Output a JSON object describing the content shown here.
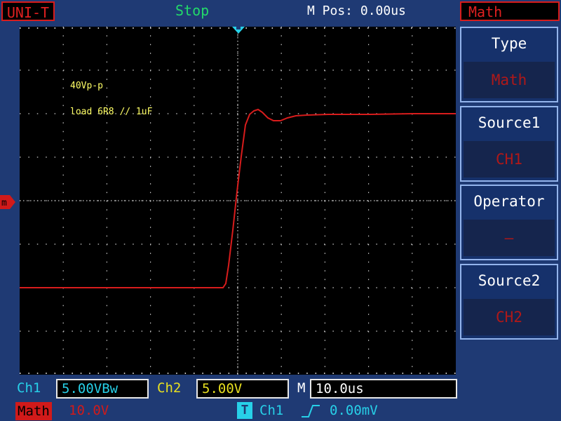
{
  "header": {
    "brand": "UNI-T",
    "run_status": "Stop",
    "m_pos": "M Pos: 0.00us"
  },
  "menu": {
    "title": "Math",
    "items": [
      {
        "label": "Type",
        "value": "Math"
      },
      {
        "label": "Source1",
        "value": "CH1"
      },
      {
        "label": "Operator",
        "value": "—"
      },
      {
        "label": "Source2",
        "value": "CH2"
      }
    ]
  },
  "screen": {
    "annotations": [
      "40Vp-p",
      "load 6R8 // 1uF"
    ],
    "trace_color": "#d81c1c",
    "grid_color": "#cccccc"
  },
  "bottom": {
    "ch1_label": "Ch1",
    "ch1_scale": "5.00VBw",
    "ch2_label": "Ch2",
    "ch2_scale": "5.00V",
    "m_label": "M",
    "m_scale": "10.0us",
    "math_label": "Math",
    "math_scale": "10.0V",
    "trig_icon": "T",
    "trig_source": "Ch1",
    "trig_edge_icon": "rising-edge-icon",
    "trig_level": "0.00mV"
  },
  "colors": {
    "ch1": "#27d0e8",
    "ch2": "#e8e020",
    "math": "#d11a1a",
    "status_stop": "#22d96a"
  }
}
